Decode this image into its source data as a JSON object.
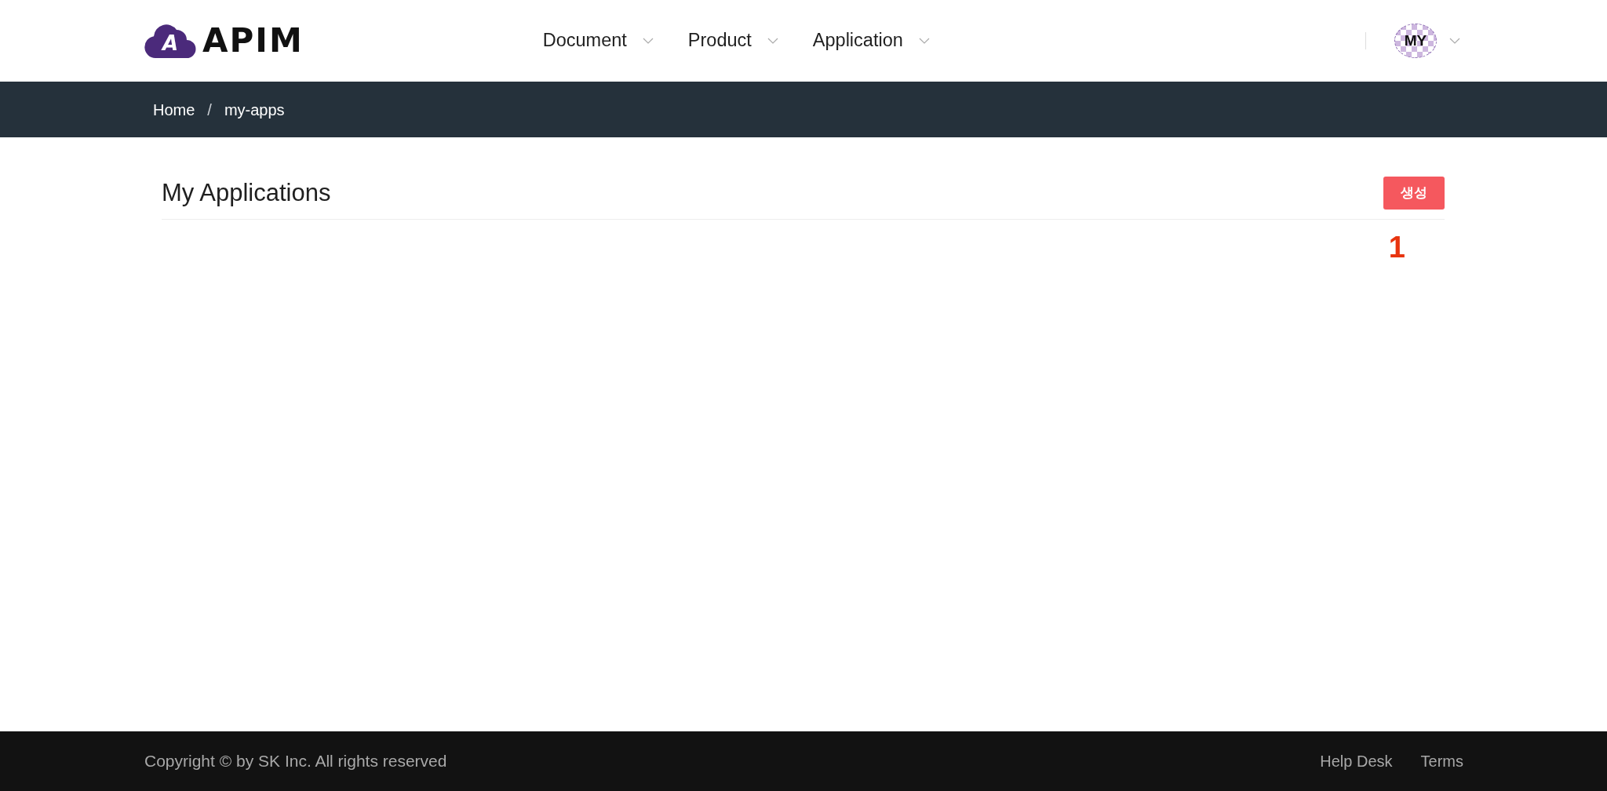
{
  "header": {
    "logo": {
      "mark_letter": "A",
      "text": "APIM"
    },
    "menu": [
      {
        "label": "Document"
      },
      {
        "label": "Product"
      },
      {
        "label": "Application"
      }
    ],
    "avatar": {
      "initials": "MY"
    }
  },
  "breadcrumb": [
    {
      "label": "Home"
    },
    {
      "label": "my-apps"
    }
  ],
  "breadcrumb_separator": "/",
  "page": {
    "title": "My Applications",
    "create_button": "생성",
    "annotation": "1"
  },
  "footer": {
    "copyright": "Copyright © by SK Inc. All rights reserved",
    "links": [
      {
        "label": "Help Desk"
      },
      {
        "label": "Terms"
      }
    ]
  }
}
